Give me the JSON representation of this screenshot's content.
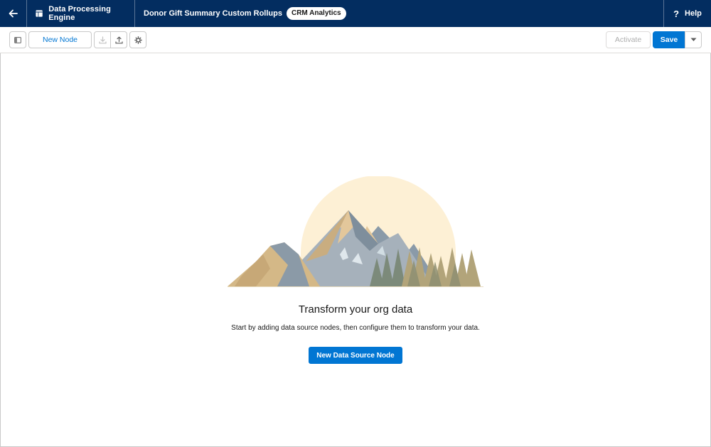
{
  "header": {
    "app_name": "Data Processing Engine",
    "record_name": "Donor Gift Summary Custom Rollups",
    "badge": "CRM Analytics",
    "help_label": "Help",
    "help_symbol": "?",
    "back_icon": "arrow-left-icon",
    "app_icon": "table-icon"
  },
  "toolbar": {
    "new_node_label": "New Node",
    "activate_label": "Activate",
    "save_label": "Save",
    "icons": [
      "panel-toggle-icon",
      "download-icon",
      "upload-icon",
      "gear-icon",
      "chevron-down-icon"
    ]
  },
  "empty_state": {
    "heading": "Transform your org data",
    "description": "Start by adding data source nodes, then configure them to transform your data.",
    "cta_label": "New Data Source Node"
  },
  "colors": {
    "header_bg": "#032d60",
    "brand_blue": "#0176d3",
    "sun": "#fdf0d5",
    "border": "#c9c9c9"
  }
}
